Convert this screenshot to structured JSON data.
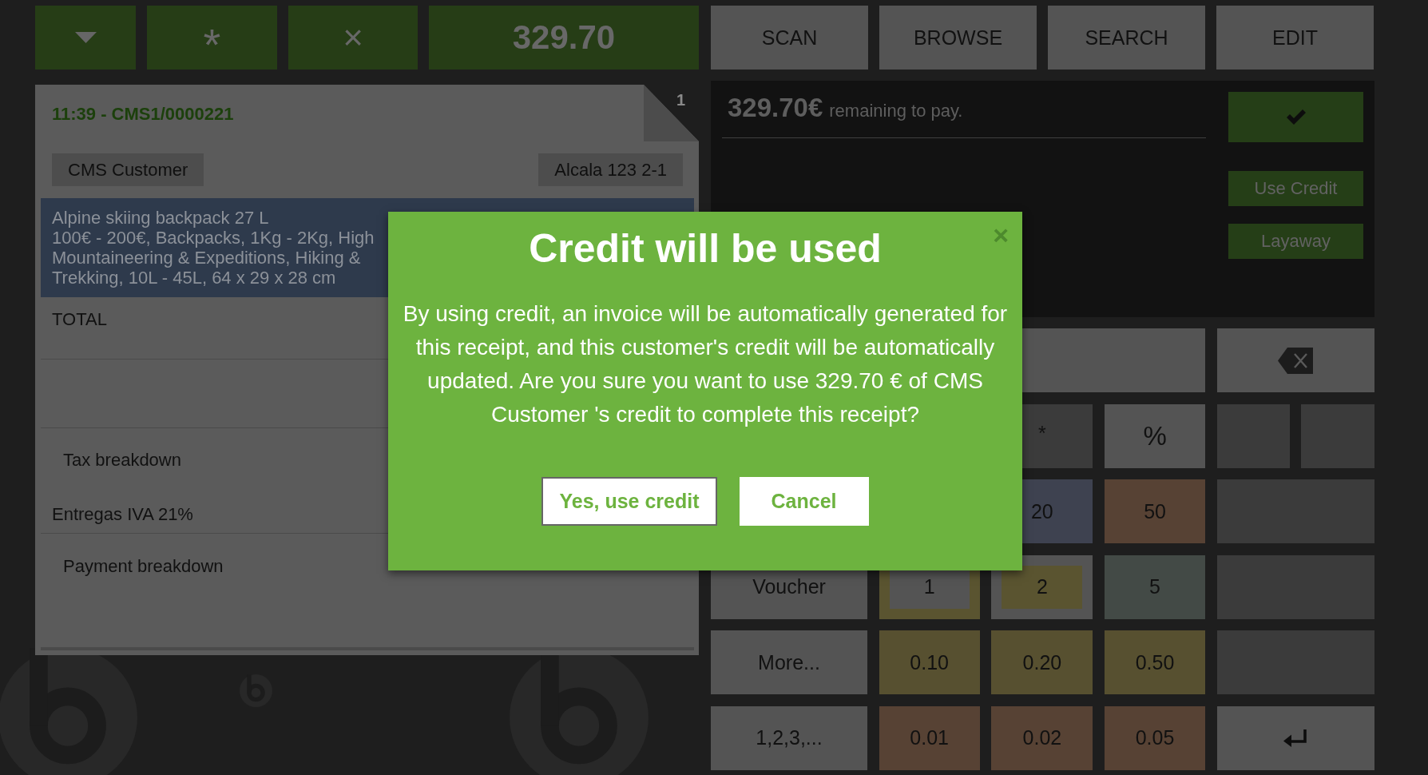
{
  "toolbar": {
    "left_buttons": [
      {
        "kind": "caret"
      },
      {
        "kind": "symbol",
        "label": "*"
      },
      {
        "kind": "symbol",
        "label": "×"
      },
      {
        "kind": "total",
        "label": "329.70"
      }
    ],
    "right_buttons": [
      {
        "label": "SCAN"
      },
      {
        "label": "BROWSE"
      },
      {
        "label": "SEARCH"
      },
      {
        "label": "EDIT"
      }
    ]
  },
  "receipt": {
    "header": "11:39 - CMS1/0000221",
    "page": "1",
    "customer": "CMS Customer",
    "address": "Alcala 123 2-1",
    "lines": [
      {
        "product": "Alpine skiing backpack 27 L",
        "attributes": "100€ - 200€, Backpacks, 1Kg - 2Kg, High Mountaineering & Expeditions, Hiking & Trekking, 10L - 45L, 64 x 29 x 28 cm",
        "selected": true
      }
    ],
    "total_label": "TOTAL",
    "tax_breakdown": {
      "title": "Tax breakdown",
      "rows": [
        {
          "label": "Entregas IVA 21%"
        }
      ]
    },
    "payment_breakdown": {
      "title": "Payment breakdown"
    }
  },
  "payment": {
    "amount": "329.70€",
    "remaining_text": "remaining to pay.",
    "actions": [
      {
        "kind": "confirm"
      },
      {
        "kind": "label",
        "label": "Use Credit"
      },
      {
        "kind": "label",
        "label": "Layaway"
      }
    ]
  },
  "keypad": {
    "operators": [
      {
        "label": "*",
        "disabled": true
      },
      {
        "label": "%",
        "disabled": false
      }
    ],
    "cash": [
      {
        "label": "20",
        "kind": "plain",
        "color": "#3e4250"
      },
      {
        "label": "50",
        "kind": "plain",
        "color": "#574234"
      },
      {
        "label": "1",
        "kind": "ring",
        "color": "#5a5430"
      },
      {
        "label": "2",
        "kind": "center",
        "color": "#5a5430"
      },
      {
        "label": "5",
        "kind": "plain",
        "color": "#434a46"
      },
      {
        "label": "0.10",
        "kind": "plain",
        "color": "#575030"
      },
      {
        "label": "0.20",
        "kind": "plain",
        "color": "#575030"
      },
      {
        "label": "0.50",
        "kind": "plain",
        "color": "#575030"
      },
      {
        "label": "0.01",
        "kind": "plain",
        "color": "#574234"
      },
      {
        "label": "0.02",
        "kind": "plain",
        "color": "#574234"
      },
      {
        "label": "0.05",
        "kind": "plain",
        "color": "#574234"
      }
    ],
    "actions": [
      {
        "label": "Voucher"
      },
      {
        "label": "More..."
      },
      {
        "label": "1,2,3,..."
      }
    ]
  },
  "dialog": {
    "title": "Credit will be used",
    "close_label": "×",
    "message": "By using credit, an invoice will be automatically generated for this receipt, and this customer's credit will be automatically updated. Are you sure you want to use 329.70 € of CMS Customer 's credit to complete this receipt?",
    "buttons": [
      {
        "label": "Yes, use credit",
        "focused": true
      },
      {
        "label": "Cancel",
        "focused": false
      }
    ]
  }
}
